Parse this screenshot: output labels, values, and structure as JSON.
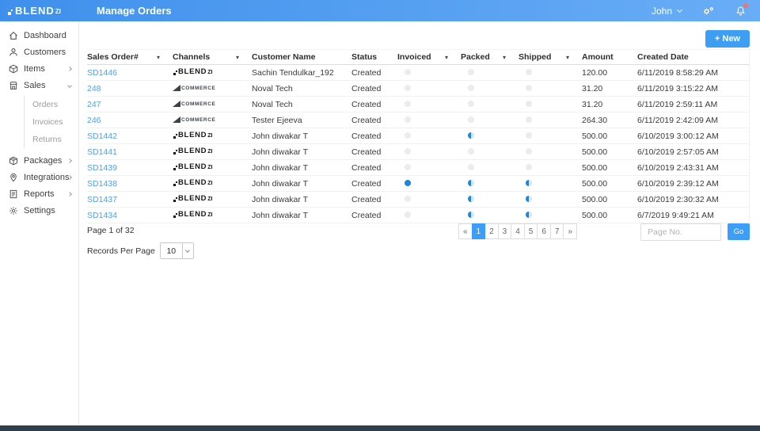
{
  "header": {
    "logo_brand": "BLEND",
    "logo_suffix": "ZI",
    "page_title": "Manage Orders",
    "user_name": "John"
  },
  "sidebar": {
    "items": [
      {
        "label": "Dashboard",
        "icon": "home-icon"
      },
      {
        "label": "Customers",
        "icon": "user-icon"
      },
      {
        "label": "Items",
        "icon": "cube-icon",
        "has_children": true
      },
      {
        "label": "Sales",
        "icon": "store-icon",
        "has_children": true,
        "expanded": true,
        "children": [
          {
            "label": "Orders",
            "active": true
          },
          {
            "label": "Invoices"
          },
          {
            "label": "Returns"
          }
        ]
      },
      {
        "label": "Packages",
        "icon": "package-icon",
        "has_children": true
      },
      {
        "label": "Integrations",
        "icon": "pin-icon",
        "has_children": true
      },
      {
        "label": "Reports",
        "icon": "document-icon",
        "has_children": true
      },
      {
        "label": "Settings",
        "icon": "gear-icon"
      }
    ]
  },
  "toolbar": {
    "new_button_label": "+ New"
  },
  "table": {
    "columns": [
      {
        "label": "Sales Order#",
        "sortable": true
      },
      {
        "label": "Channels",
        "sortable": true
      },
      {
        "label": "Customer Name",
        "sortable": false
      },
      {
        "label": "Status",
        "sortable": false
      },
      {
        "label": "Invoiced",
        "sortable": true
      },
      {
        "label": "Packed",
        "sortable": true
      },
      {
        "label": "Shipped",
        "sortable": true
      },
      {
        "label": "Amount",
        "sortable": false
      },
      {
        "label": "Created Date",
        "sortable": false
      }
    ],
    "rows": [
      {
        "order_no": "SD1446",
        "channel": "blendzi",
        "customer": "Sachin Tendulkar_192",
        "status": "Created",
        "invoiced": "none",
        "packed": "none",
        "shipped": "none",
        "amount": "120.00",
        "created_date": "6/11/2019 8:58:29 AM"
      },
      {
        "order_no": "248",
        "channel": "bigcommerce",
        "customer": "Noval Tech",
        "status": "Created",
        "invoiced": "none",
        "packed": "none",
        "shipped": "none",
        "amount": "31.20",
        "created_date": "6/11/2019 3:15:22 AM"
      },
      {
        "order_no": "247",
        "channel": "bigcommerce",
        "customer": "Noval Tech",
        "status": "Created",
        "invoiced": "none",
        "packed": "none",
        "shipped": "none",
        "amount": "31.20",
        "created_date": "6/11/2019 2:59:11 AM"
      },
      {
        "order_no": "246",
        "channel": "bigcommerce",
        "customer": "Tester Ejeeva",
        "status": "Created",
        "invoiced": "none",
        "packed": "none",
        "shipped": "none",
        "amount": "264.30",
        "created_date": "6/11/2019 2:42:09 AM"
      },
      {
        "order_no": "SD1442",
        "channel": "blendzi",
        "customer": "John diwakar T",
        "status": "Created",
        "invoiced": "none",
        "packed": "partial",
        "shipped": "none",
        "amount": "500.00",
        "created_date": "6/10/2019 3:00:12 AM"
      },
      {
        "order_no": "SD1441",
        "channel": "blendzi",
        "customer": "John diwakar T",
        "status": "Created",
        "invoiced": "none",
        "packed": "none",
        "shipped": "none",
        "amount": "500.00",
        "created_date": "6/10/2019 2:57:05 AM"
      },
      {
        "order_no": "SD1439",
        "channel": "blendzi",
        "customer": "John diwakar T",
        "status": "Created",
        "invoiced": "none",
        "packed": "none",
        "shipped": "none",
        "amount": "500.00",
        "created_date": "6/10/2019 2:43:31 AM"
      },
      {
        "order_no": "SD1438",
        "channel": "blendzi",
        "customer": "John diwakar T",
        "status": "Created",
        "invoiced": "full",
        "packed": "partial",
        "shipped": "partial",
        "amount": "500.00",
        "created_date": "6/10/2019 2:39:12 AM"
      },
      {
        "order_no": "SD1437",
        "channel": "blendzi",
        "customer": "John diwakar T",
        "status": "Created",
        "invoiced": "none",
        "packed": "partial",
        "shipped": "partial",
        "amount": "500.00",
        "created_date": "6/10/2019 2:30:32 AM"
      },
      {
        "order_no": "SD1434",
        "channel": "blendzi",
        "customer": "John diwakar T",
        "status": "Created",
        "invoiced": "none",
        "packed": "partial",
        "shipped": "partial",
        "amount": "500.00",
        "created_date": "6/7/2019 9:49:21 AM"
      }
    ]
  },
  "channel_logos": {
    "blendzi_brand": "BLEND",
    "blendzi_suffix": "ZI",
    "bigcommerce_text": "COMMERCE"
  },
  "pagination": {
    "summary": "Page 1 of 32",
    "records_per_page_label": "Records Per Page",
    "records_per_page_value": "10",
    "pages": [
      "«",
      "1",
      "2",
      "3",
      "4",
      "5",
      "6",
      "7",
      "»"
    ],
    "active_page": "1",
    "page_input_placeholder": "Page No.",
    "go_label": "Go"
  },
  "colors": {
    "header_gradient_start": "#3f90ec",
    "header_gradient_end": "#69adf6",
    "accent_blue": "#3d9ef7",
    "link_blue": "#4f9ff2",
    "status_blue": "#1d86dc",
    "status_grey": "#ececec",
    "notification_red": "#fc6e68",
    "footer_dark": "#2e3e4e"
  }
}
